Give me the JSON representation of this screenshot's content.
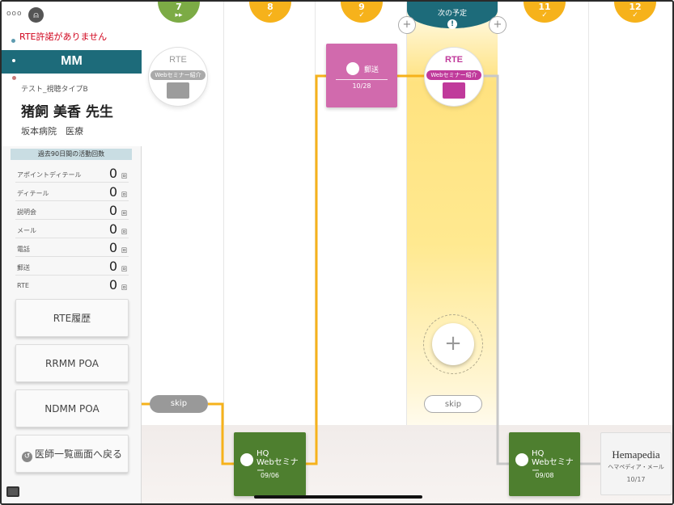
{
  "sidebar": {
    "dots": "ooo",
    "logo_glyph": "⍝",
    "warning": "RTE許諾がありません",
    "segment": "MM",
    "view_type": "テスト_視聴タイプB",
    "doctor_name": "猪飼 美香 先生",
    "hospital": "坂本病院　医療",
    "activity_header": "過去90日間の活動回数",
    "activities": [
      {
        "label": "アポイントディテール",
        "value": "0",
        "unit": "回"
      },
      {
        "label": "ディテール",
        "value": "0",
        "unit": "回"
      },
      {
        "label": "説明会",
        "value": "0",
        "unit": "回"
      },
      {
        "label": "メール",
        "value": "0",
        "unit": "回"
      },
      {
        "label": "電話",
        "value": "0",
        "unit": "回"
      },
      {
        "label": "郵送",
        "value": "0",
        "unit": "回"
      },
      {
        "label": "RTE",
        "value": "0",
        "unit": "回"
      }
    ],
    "buttons": {
      "rte_history": "RTE履歴",
      "rrmm_poa": "RRMM POA",
      "ndmm_poa": "NDMM POA",
      "back": "医師一覧画面へ戻る"
    },
    "colors": {
      "accent": "#1d6b7a",
      "warning": "#d0021b"
    }
  },
  "timeline": {
    "tabs": [
      {
        "num": "7",
        "sub": "▸▸",
        "color": "#7cab45"
      },
      {
        "num": "8",
        "sub": "✓",
        "color": "#f6b21b"
      },
      {
        "num": "9",
        "sub": "✓",
        "color": "#f6b21b"
      },
      {
        "num": "11",
        "sub": "✓",
        "color": "#f6b21b"
      },
      {
        "num": "12",
        "sub": "✓",
        "color": "#f6b21b"
      }
    ],
    "next_label": "次の予定",
    "next_icon": "!",
    "plus_glyph": "+",
    "cards": {
      "rte_past": {
        "title": "RTE",
        "pill": "Webセミナー紹介"
      },
      "mail": {
        "label": "郵送",
        "date": "10/28",
        "color": "#d16aad"
      },
      "rte_next": {
        "title": "RTE",
        "pill": "Webセミナー紹介"
      },
      "hq_1": {
        "line1": "HQ",
        "line2": "Webセミナー",
        "date": "09/06",
        "color": "#4e7f2f"
      },
      "hq_2": {
        "line1": "HQ",
        "line2": "Webセミナー",
        "date": "09/08",
        "color": "#4e7f2f"
      },
      "hemapedia": {
        "brand": "Hemapedia",
        "sub": "ヘマペディア・メール",
        "date": "10/17"
      }
    },
    "skip_label": "skip",
    "path_color": "#f6b21b"
  }
}
